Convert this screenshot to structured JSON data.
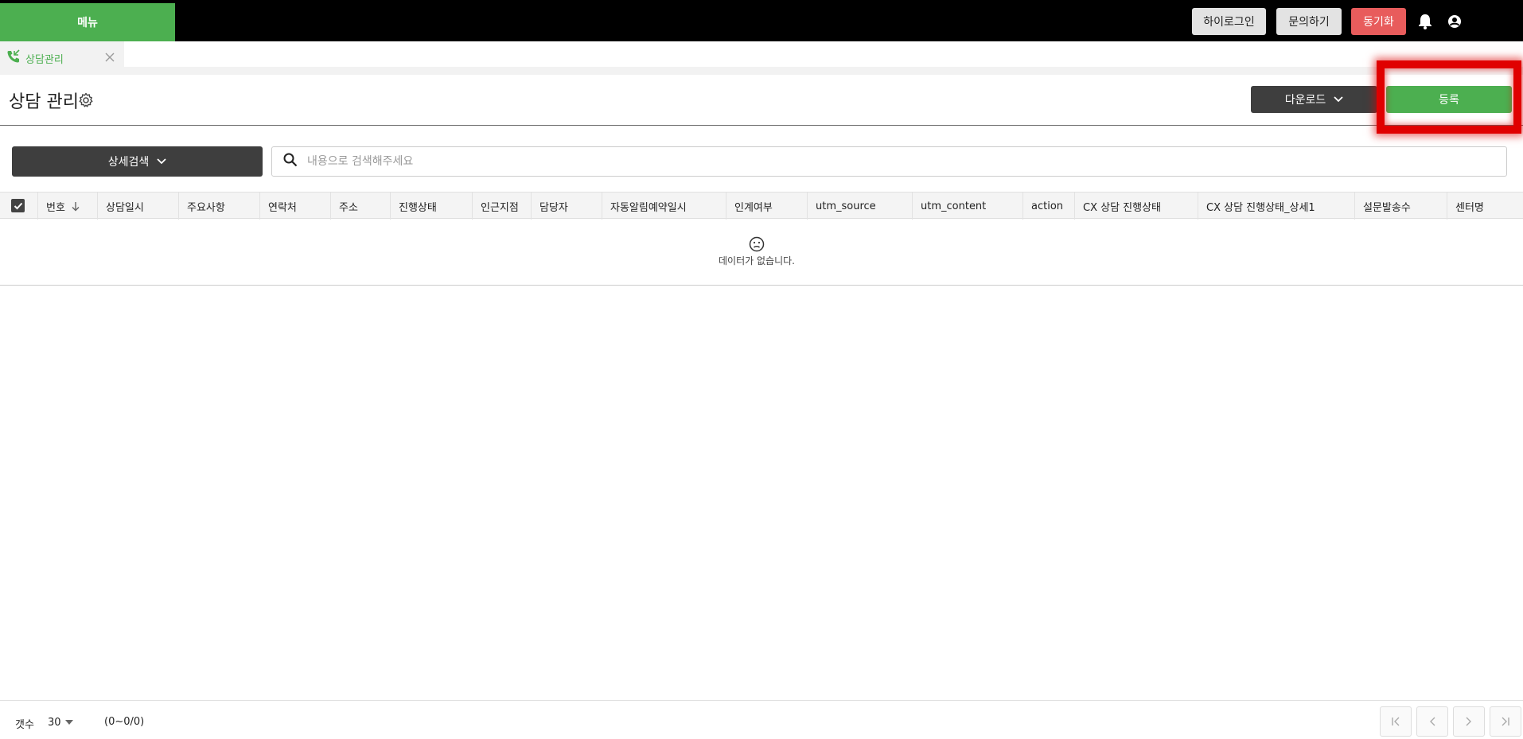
{
  "topbar": {
    "menu_label": "메뉴",
    "buttons": [
      {
        "label": "하이로그인"
      },
      {
        "label": "문의하기"
      },
      {
        "label": "동기화"
      }
    ]
  },
  "tabs": [
    {
      "label": "상담관리"
    }
  ],
  "header": {
    "title": "상담 관리",
    "download_label": "다운로드",
    "register_label": "등록"
  },
  "search": {
    "advanced_label": "상세검색",
    "placeholder": "내용으로 검색해주세요",
    "value": ""
  },
  "table": {
    "columns": [
      "번호",
      "상담일시",
      "주요사항",
      "연락처",
      "주소",
      "진행상태",
      "인근지점",
      "담당자",
      "자동알림예약일시",
      "인계여부",
      "utm_source",
      "utm_content",
      "action",
      "CX 상담 진행상태",
      "CX 상담 진행상태_상세1",
      "설문발송수",
      "센터명"
    ],
    "empty_text": "데이터가 없습니다."
  },
  "footer": {
    "count_label": "갯수",
    "page_size": "30",
    "range": "(0~0/0)"
  },
  "colors": {
    "brand_green": "#4caf50",
    "dark_button": "#3e3e3e",
    "sync_red": "#e85c5c",
    "highlight": "#e00000"
  }
}
